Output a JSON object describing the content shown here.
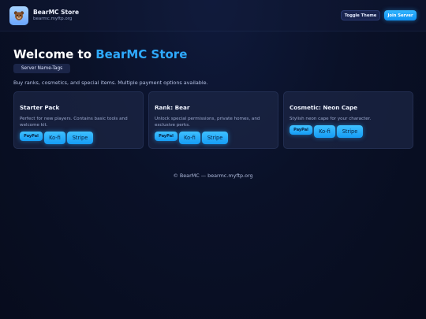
{
  "header": {
    "title": "BearMC Store",
    "subtitle": "bearmc.myftp.org",
    "logo_icon": "bear-icon",
    "toggle_label": "Toggle Theme",
    "join_label": "Join Server"
  },
  "hero": {
    "title_prefix": "Welcome to ",
    "title_accent": "BearMC Store",
    "tag": "Server Name-Tags",
    "description": "Buy ranks, cosmetics, and special items. Multiple payment options available."
  },
  "products": [
    {
      "title": "Starter Pack",
      "description": "Perfect for new players. Contains basic tools and welcome kit.",
      "payments": [
        "PayPal",
        "Ko-fi",
        "Stripe"
      ]
    },
    {
      "title": "Rank: Bear",
      "description": "Unlock special permissions, private homes, and exclusive perks.",
      "payments": [
        "PayPal",
        "Ko-fi",
        "Stripe"
      ]
    },
    {
      "title": "Cosmetic: Neon Cape",
      "description": "Stylish neon cape for your character.",
      "payments": [
        "PayPal",
        "Ko-fi",
        "Stripe"
      ]
    }
  ],
  "footer": {
    "text": "© BearMC — bearmc.myftp.org"
  },
  "colors": {
    "accent": "#2eaaff",
    "background": "#0a1128",
    "card": "#1c2646"
  }
}
